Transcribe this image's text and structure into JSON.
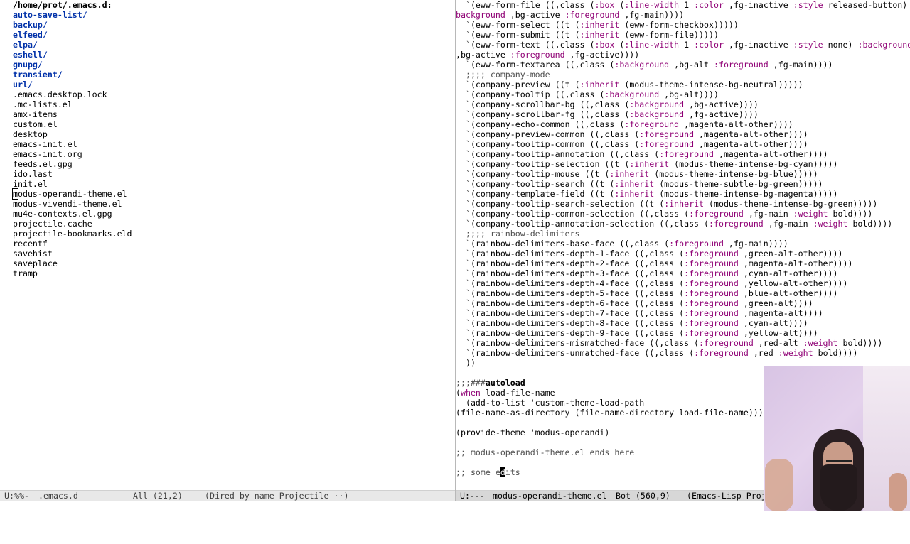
{
  "left_pane": {
    "header": "/home/prot/.emacs.d:",
    "directories": [
      "auto-save-list/",
      "backup/",
      "elfeed/",
      "elpa/",
      "eshell/",
      "gnupg/",
      "transient/",
      "url/"
    ],
    "files": [
      ".emacs.desktop.lock",
      ".mc-lists.el",
      "amx-items",
      "custom.el",
      "desktop",
      "emacs-init.el",
      "emacs-init.org",
      "feeds.el.gpg",
      "ido.last",
      "init.el",
      "modus-operandi-theme.el",
      "modus-vivendi-theme.el",
      "mu4e-contexts.el.gpg",
      "projectile.cache",
      "projectile-bookmarks.eld",
      "recentf",
      "savehist",
      "saveplace",
      "tramp"
    ],
    "cursor_file_first_char": "m",
    "cursor_file_rest": "odus-operandi-theme.el"
  },
  "left_modeline": {
    "status": "U:%%-",
    "buffer": ".emacs.d",
    "position": "All (21,2)",
    "modes": "(Dired by name Projectile ··)"
  },
  "right_pane": {
    "lines": [
      [
        [
          "ind",
          "  `"
        ],
        [
          "t",
          "(eww-form-file ((,class ("
        ],
        [
          "kw",
          ":box"
        ],
        [
          "t",
          " ("
        ],
        [
          "kw",
          ":line-width"
        ],
        [
          "t",
          " 1 "
        ],
        [
          "kw",
          ":color"
        ],
        [
          "t",
          " ,fg-inactive "
        ],
        [
          "kw",
          ":style"
        ],
        [
          "t",
          " released-button) :"
        ]
      ],
      [
        [
          "kw",
          "background"
        ],
        [
          "t",
          " ,bg-active "
        ],
        [
          "kw",
          ":foreground"
        ],
        [
          "t",
          " ,fg-main))))"
        ]
      ],
      [
        [
          "ind",
          "  `"
        ],
        [
          "t",
          "(eww-form-select ((t ("
        ],
        [
          "kw",
          ":inherit"
        ],
        [
          "t",
          " (eww-form-checkbox)))))"
        ]
      ],
      [
        [
          "ind",
          "  `"
        ],
        [
          "t",
          "(eww-form-submit ((t ("
        ],
        [
          "kw",
          ":inherit"
        ],
        [
          "t",
          " (eww-form-file)))))"
        ]
      ],
      [
        [
          "ind",
          "  `"
        ],
        [
          "t",
          "(eww-form-text ((,class ("
        ],
        [
          "kw",
          ":box"
        ],
        [
          "t",
          " ("
        ],
        [
          "kw",
          ":line-width"
        ],
        [
          "t",
          " 1 "
        ],
        [
          "kw",
          ":color"
        ],
        [
          "t",
          " ,fg-inactive "
        ],
        [
          "kw",
          ":style"
        ],
        [
          "t",
          " none) "
        ],
        [
          "kw",
          ":background"
        ]
      ],
      [
        [
          "t",
          ",bg-active "
        ],
        [
          "kw",
          ":foreground"
        ],
        [
          "t",
          " ,fg-active))))"
        ]
      ],
      [
        [
          "ind",
          "  `"
        ],
        [
          "t",
          "(eww-form-textarea ((,class ("
        ],
        [
          "kw",
          ":background"
        ],
        [
          "t",
          " ,bg-alt "
        ],
        [
          "kw",
          ":foreground"
        ],
        [
          "t",
          " ,fg-main))))"
        ]
      ],
      [
        [
          "cmt",
          "  ;;;; company-mode"
        ]
      ],
      [
        [
          "ind",
          "  `"
        ],
        [
          "t",
          "(company-preview ((t ("
        ],
        [
          "kw",
          ":inherit"
        ],
        [
          "t",
          " (modus-theme-intense-bg-neutral)))))"
        ]
      ],
      [
        [
          "ind",
          "  `"
        ],
        [
          "t",
          "(company-tooltip ((,class ("
        ],
        [
          "kw",
          ":background"
        ],
        [
          "t",
          " ,bg-alt))))"
        ]
      ],
      [
        [
          "ind",
          "  `"
        ],
        [
          "t",
          "(company-scrollbar-bg ((,class ("
        ],
        [
          "kw",
          ":background"
        ],
        [
          "t",
          " ,bg-active))))"
        ]
      ],
      [
        [
          "ind",
          "  `"
        ],
        [
          "t",
          "(company-scrollbar-fg ((,class ("
        ],
        [
          "kw",
          ":background"
        ],
        [
          "t",
          " ,fg-active))))"
        ]
      ],
      [
        [
          "ind",
          "  `"
        ],
        [
          "t",
          "(company-echo-common ((,class ("
        ],
        [
          "kw",
          ":foreground"
        ],
        [
          "t",
          " ,magenta-alt-other))))"
        ]
      ],
      [
        [
          "ind",
          "  `"
        ],
        [
          "t",
          "(company-preview-common ((,class ("
        ],
        [
          "kw",
          ":foreground"
        ],
        [
          "t",
          " ,magenta-alt-other))))"
        ]
      ],
      [
        [
          "ind",
          "  `"
        ],
        [
          "t",
          "(company-tooltip-common ((,class ("
        ],
        [
          "kw",
          ":foreground"
        ],
        [
          "t",
          " ,magenta-alt-other))))"
        ]
      ],
      [
        [
          "ind",
          "  `"
        ],
        [
          "t",
          "(company-tooltip-annotation ((,class ("
        ],
        [
          "kw",
          ":foreground"
        ],
        [
          "t",
          " ,magenta-alt-other))))"
        ]
      ],
      [
        [
          "ind",
          "  `"
        ],
        [
          "t",
          "(company-tooltip-selection ((t ("
        ],
        [
          "kw",
          ":inherit"
        ],
        [
          "t",
          " (modus-theme-intense-bg-cyan)))))"
        ]
      ],
      [
        [
          "ind",
          "  `"
        ],
        [
          "t",
          "(company-tooltip-mouse ((t ("
        ],
        [
          "kw",
          ":inherit"
        ],
        [
          "t",
          " (modus-theme-intense-bg-blue)))))"
        ]
      ],
      [
        [
          "ind",
          "  `"
        ],
        [
          "t",
          "(company-tooltip-search ((t ("
        ],
        [
          "kw",
          ":inherit"
        ],
        [
          "t",
          " (modus-theme-subtle-bg-green)))))"
        ]
      ],
      [
        [
          "ind",
          "  `"
        ],
        [
          "t",
          "(company-template-field ((t ("
        ],
        [
          "kw",
          ":inherit"
        ],
        [
          "t",
          " (modus-theme-intense-bg-magenta)))))"
        ]
      ],
      [
        [
          "ind",
          "  `"
        ],
        [
          "t",
          "(company-tooltip-search-selection ((t ("
        ],
        [
          "kw",
          ":inherit"
        ],
        [
          "t",
          " (modus-theme-intense-bg-green)))))"
        ]
      ],
      [
        [
          "ind",
          "  `"
        ],
        [
          "t",
          "(company-tooltip-common-selection ((,class ("
        ],
        [
          "kw",
          ":foreground"
        ],
        [
          "t",
          " ,fg-main "
        ],
        [
          "kw",
          ":weight"
        ],
        [
          "t",
          " bold))))"
        ]
      ],
      [
        [
          "ind",
          "  `"
        ],
        [
          "t",
          "(company-tooltip-annotation-selection ((,class ("
        ],
        [
          "kw",
          ":foreground"
        ],
        [
          "t",
          " ,fg-main "
        ],
        [
          "kw",
          ":weight"
        ],
        [
          "t",
          " bold))))"
        ]
      ],
      [
        [
          "cmt",
          "  ;;;; rainbow-delimiters"
        ]
      ],
      [
        [
          "ind",
          "  `"
        ],
        [
          "t",
          "(rainbow-delimiters-base-face ((,class ("
        ],
        [
          "kw",
          ":foreground"
        ],
        [
          "t",
          " ,fg-main))))"
        ]
      ],
      [
        [
          "ind",
          "  `"
        ],
        [
          "t",
          "(rainbow-delimiters-depth-1-face ((,class ("
        ],
        [
          "kw",
          ":foreground"
        ],
        [
          "t",
          " ,green-alt-other))))"
        ]
      ],
      [
        [
          "ind",
          "  `"
        ],
        [
          "t",
          "(rainbow-delimiters-depth-2-face ((,class ("
        ],
        [
          "kw",
          ":foreground"
        ],
        [
          "t",
          " ,magenta-alt-other))))"
        ]
      ],
      [
        [
          "ind",
          "  `"
        ],
        [
          "t",
          "(rainbow-delimiters-depth-3-face ((,class ("
        ],
        [
          "kw",
          ":foreground"
        ],
        [
          "t",
          " ,cyan-alt-other))))"
        ]
      ],
      [
        [
          "ind",
          "  `"
        ],
        [
          "t",
          "(rainbow-delimiters-depth-4-face ((,class ("
        ],
        [
          "kw",
          ":foreground"
        ],
        [
          "t",
          " ,yellow-alt-other))))"
        ]
      ],
      [
        [
          "ind",
          "  `"
        ],
        [
          "t",
          "(rainbow-delimiters-depth-5-face ((,class ("
        ],
        [
          "kw",
          ":foreground"
        ],
        [
          "t",
          " ,blue-alt-other))))"
        ]
      ],
      [
        [
          "ind",
          "  `"
        ],
        [
          "t",
          "(rainbow-delimiters-depth-6-face ((,class ("
        ],
        [
          "kw",
          ":foreground"
        ],
        [
          "t",
          " ,green-alt))))"
        ]
      ],
      [
        [
          "ind",
          "  `"
        ],
        [
          "t",
          "(rainbow-delimiters-depth-7-face ((,class ("
        ],
        [
          "kw",
          ":foreground"
        ],
        [
          "t",
          " ,magenta-alt))))"
        ]
      ],
      [
        [
          "ind",
          "  `"
        ],
        [
          "t",
          "(rainbow-delimiters-depth-8-face ((,class ("
        ],
        [
          "kw",
          ":foreground"
        ],
        [
          "t",
          " ,cyan-alt))))"
        ]
      ],
      [
        [
          "ind",
          "  `"
        ],
        [
          "t",
          "(rainbow-delimiters-depth-9-face ((,class ("
        ],
        [
          "kw",
          ":foreground"
        ],
        [
          "t",
          " ,yellow-alt))))"
        ]
      ],
      [
        [
          "ind",
          "  `"
        ],
        [
          "t",
          "(rainbow-delimiters-mismatched-face ((,class ("
        ],
        [
          "kw",
          ":foreground"
        ],
        [
          "t",
          " ,red-alt "
        ],
        [
          "kw",
          ":weight"
        ],
        [
          "t",
          " bold))))"
        ]
      ],
      [
        [
          "ind",
          "  `"
        ],
        [
          "t",
          "(rainbow-delimiters-unmatched-face ((,class ("
        ],
        [
          "kw",
          ":foreground"
        ],
        [
          "t",
          " ,red "
        ],
        [
          "kw",
          ":weight"
        ],
        [
          "t",
          " bold))))"
        ]
      ],
      [
        [
          "t",
          "  ))"
        ]
      ],
      [
        [
          "t",
          ""
        ]
      ],
      [
        [
          "cmt",
          ";;;###"
        ],
        [
          "bold",
          "autoload"
        ]
      ],
      [
        [
          "t",
          "("
        ],
        [
          "kw",
          "when"
        ],
        [
          "t",
          " load-file-name"
        ]
      ],
      [
        [
          "t",
          "  (add-to-list 'custom-theme-load-path"
        ]
      ],
      [
        [
          "t",
          "(file-name-as-directory (file-name-directory load-file-name))))"
        ]
      ],
      [
        [
          "t",
          ""
        ]
      ],
      [
        [
          "t",
          "(provide-theme 'modus-operandi)"
        ]
      ],
      [
        [
          "t",
          ""
        ]
      ],
      [
        [
          "cmt",
          ";; modus-operandi-theme.el ends here"
        ]
      ],
      [
        [
          "t",
          ""
        ]
      ],
      [
        [
          "cmt",
          ";; some e"
        ],
        [
          "cur",
          "d"
        ],
        [
          "cmt",
          "its"
        ]
      ]
    ]
  },
  "right_modeline": {
    "status": "U:---",
    "buffer": "modus-operandi-theme.el",
    "position": "Bot (560,9)",
    "modes": "(Emacs-Lisp Proj"
  },
  "colors": {
    "directory": "#0031a9",
    "keyword": "#8f0075",
    "comment": "#505050",
    "modeline_active": "#d7d7d7",
    "modeline_inactive": "#e8e8e8"
  }
}
